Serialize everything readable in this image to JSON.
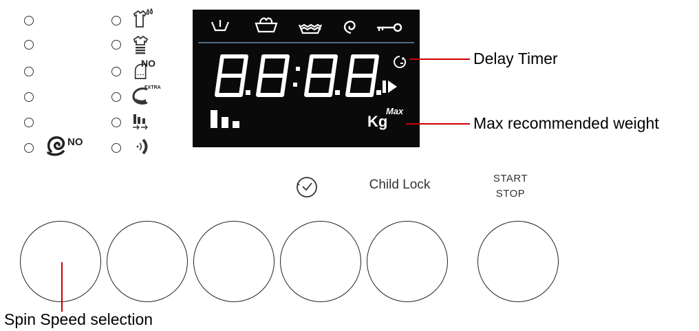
{
  "panel": {
    "option_leds": [
      {
        "name": "pre-wash-icon"
      },
      {
        "name": "easy-iron-icon"
      },
      {
        "name": "no-iron-icon"
      },
      {
        "name": "extra-rinse-icon"
      },
      {
        "name": "load-level-icon"
      },
      {
        "name": "sound-icon"
      }
    ],
    "spin_icon_label": "NO",
    "no_iron_label": "NO",
    "extra_label": "EXTRA"
  },
  "display": {
    "status_icons": [
      "wash-icon",
      "cotton-icon",
      "rinse-icon",
      "spin-icon",
      "key-icon"
    ],
    "digits": "8.8:8.8.",
    "kg_label": "Kg",
    "max_label": "Max"
  },
  "buttons": {
    "child_lock_label": "Child Lock",
    "start_label": "START",
    "stop_label": "STOP"
  },
  "callouts": {
    "delay_timer": "Delay Timer",
    "max_weight": "Max recommended weight",
    "spin_speed": "Spin Speed selection"
  },
  "colors": {
    "display_bg": "#0a0a0a",
    "display_fg": "#ffffff",
    "callout_line": "#cc0000",
    "divider": "#6a8cab"
  }
}
